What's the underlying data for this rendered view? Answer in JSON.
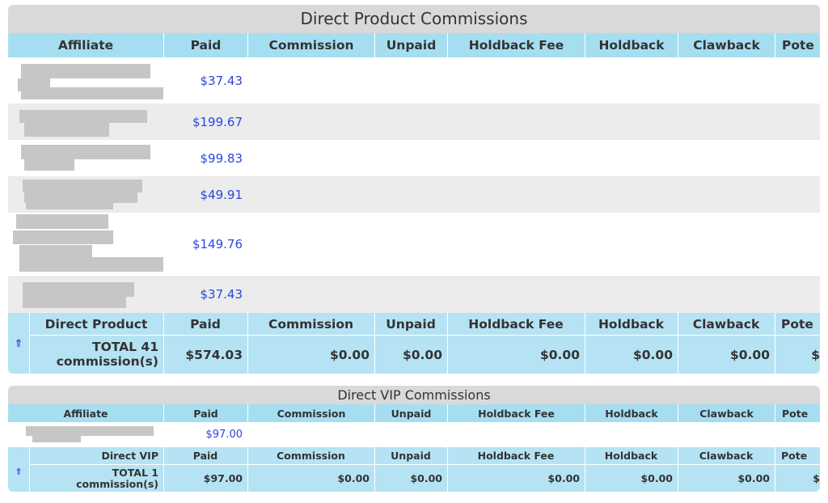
{
  "sections": [
    {
      "title": "Direct Product Commissions",
      "columns": [
        "Affiliate",
        "Paid",
        "Commission",
        "Unpaid",
        "Holdback Fee",
        "Holdback",
        "Clawback",
        "Pote"
      ],
      "rows": [
        {
          "paid": "$37.43"
        },
        {
          "paid": "$199.67"
        },
        {
          "paid": "$99.83"
        },
        {
          "paid": "$49.91"
        },
        {
          "paid": "$149.76"
        },
        {
          "paid": "$37.43"
        }
      ],
      "total": {
        "columns": [
          "Direct Product",
          "Paid",
          "Commission",
          "Unpaid",
          "Holdback Fee",
          "Holdback",
          "Clawback",
          "Pote"
        ],
        "label": "TOTAL 41 commission(s)",
        "values": [
          "$574.03",
          "$0.00",
          "$0.00",
          "$0.00",
          "$0.00",
          "$0.00",
          "$"
        ]
      }
    },
    {
      "title": "Direct VIP Commissions",
      "columns": [
        "Affiliate",
        "Paid",
        "Commission",
        "Unpaid",
        "Holdback Fee",
        "Holdback",
        "Clawback",
        "Pote"
      ],
      "rows": [
        {
          "paid": "$97.00"
        }
      ],
      "total": {
        "columns": [
          "Direct VIP",
          "Paid",
          "Commission",
          "Unpaid",
          "Holdback Fee",
          "Holdback",
          "Clawback",
          "Pote"
        ],
        "label": "TOTAL 1 commission(s)",
        "values": [
          "$97.00",
          "$0.00",
          "$0.00",
          "$0.00",
          "$0.00",
          "$0.00",
          "$"
        ]
      }
    }
  ],
  "icons": {
    "back_to_top": "double-up-arrow-icon"
  },
  "colors": {
    "header_bg": "#a6def1",
    "total_bg": "#b5e3f4",
    "title_bg": "#d9d9d9",
    "paid_text": "#2a46e0",
    "alt_row": "#ececec"
  }
}
